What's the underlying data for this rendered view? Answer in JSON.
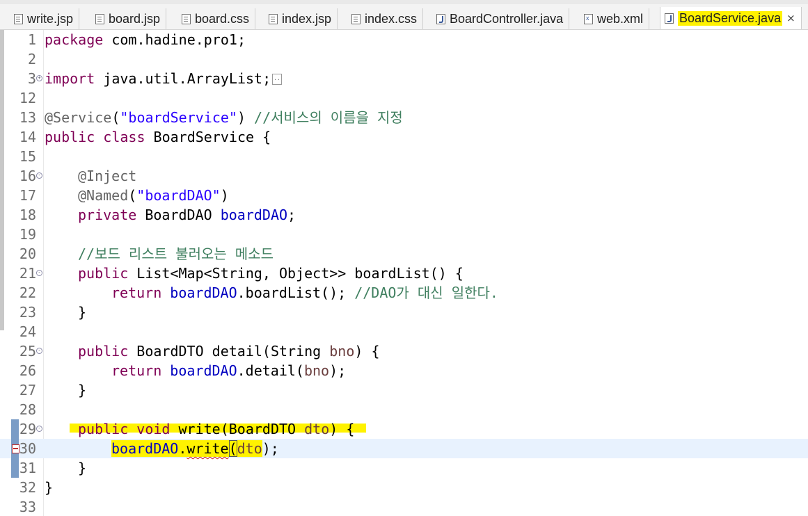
{
  "tabs": [
    {
      "label": "write.jsp",
      "icon": "file-icon",
      "active": false
    },
    {
      "label": "board.jsp",
      "icon": "file-icon",
      "active": false
    },
    {
      "label": "board.css",
      "icon": "file-icon",
      "active": false
    },
    {
      "label": "index.jsp",
      "icon": "file-icon",
      "active": false
    },
    {
      "label": "index.css",
      "icon": "file-icon",
      "active": false
    },
    {
      "label": "BoardController.java",
      "icon": "java-file-icon",
      "active": false
    },
    {
      "label": "web.xml",
      "icon": "xml-file-icon",
      "active": false
    },
    {
      "label": "BoardService.java",
      "icon": "java-file-icon",
      "active": true
    }
  ],
  "close_glyph": "×",
  "highlight_color": "#fff200",
  "current_line_color": "#e8f2fe",
  "line_numbers": [
    "1",
    "2",
    "3",
    "12",
    "13",
    "14",
    "15",
    "16",
    "17",
    "18",
    "19",
    "20",
    "21",
    "22",
    "23",
    "24",
    "25",
    "26",
    "27",
    "28",
    "29",
    "30",
    "31",
    "32",
    "33"
  ],
  "code": {
    "l1_kw": "package",
    "l1_rest": " com.hadine.pro1;",
    "l3_kw": "import",
    "l3_rest": " java.util.ArrayList;",
    "l13_ann": "@Service",
    "l13_p1": "(",
    "l13_str": "\"boardService\"",
    "l13_p2": ") ",
    "l13_cm": "//서비스의 이름을 지정",
    "l14_kw": "public class",
    "l14_rest": " BoardService {",
    "l16_ann": "@Inject",
    "l17_ann": "@Named",
    "l17_p1": "(",
    "l17_str": "\"boardDAO\"",
    "l17_p2": ")",
    "l18_kw": "private",
    "l18_type": " BoardDAO ",
    "l18_fld": "boardDAO",
    "l18_end": ";",
    "l20_cm": "//보드 리스트 불러오는 메소드",
    "l21_kw": "public",
    "l21_rest": " List<Map<String, Object>> boardList() {",
    "l22_kw": "return",
    "l22_sp": " ",
    "l22_fld": "boardDAO",
    "l22_rest": ".boardList(); ",
    "l22_cm": "//DAO가 대신 일한다.",
    "l23_brace": "}",
    "l25_kw": "public",
    "l25_rest1": " BoardDTO detail(String ",
    "l25_prm": "bno",
    "l25_rest2": ") {",
    "l26_kw": "return",
    "l26_sp": " ",
    "l26_fld": "boardDAO",
    "l26_rest1": ".detail(",
    "l26_prm": "bno",
    "l26_rest2": ");",
    "l27_brace": "}",
    "l29_kw1": "public",
    "l29_sp": " ",
    "l29_kw2": "void",
    "l29_rest1": " write(BoardDTO ",
    "l29_prm": "dto",
    "l29_rest2": ") {",
    "l30_fld": "boardDAO",
    "l30_dot": ".",
    "l30_method": "write",
    "l30_paren": "(",
    "l30_prm": "dto",
    "l30_end": ");",
    "l31_brace": "}",
    "l32_brace": "}"
  }
}
